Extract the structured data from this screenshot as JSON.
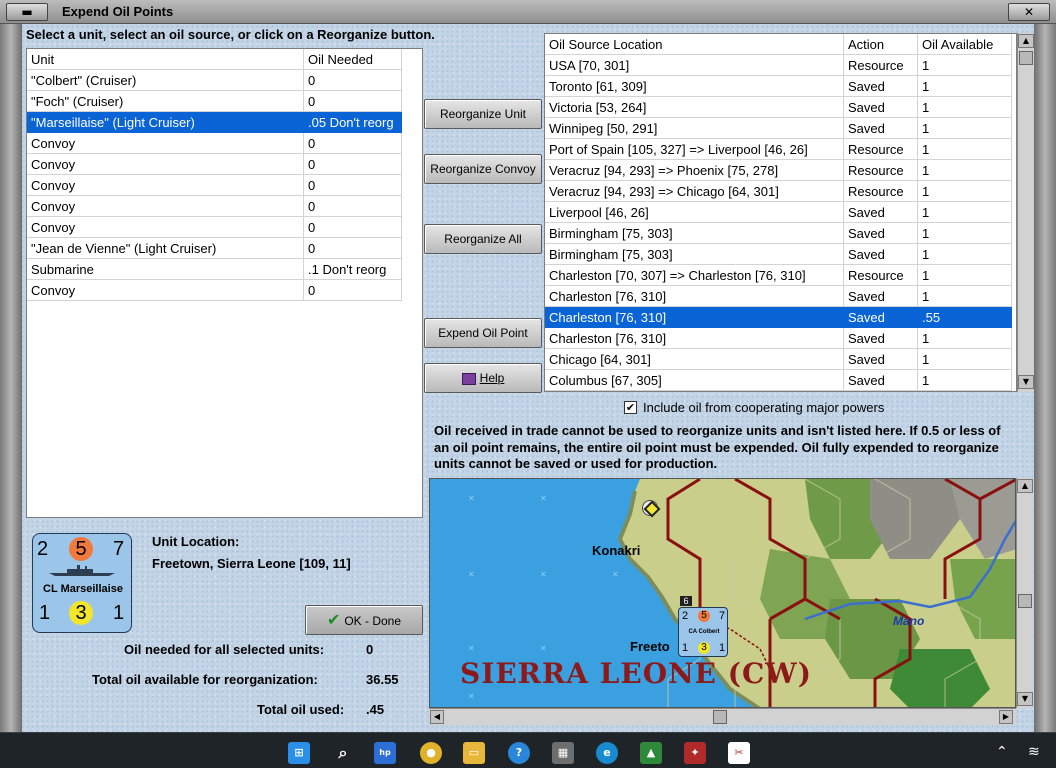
{
  "window": {
    "title": "Expend Oil Points",
    "min_label": "▬",
    "close_label": "✕"
  },
  "instruction": "Select a unit, select an oil source, or click on a Reorganize button.",
  "units_table": {
    "headers": [
      "Unit",
      "Oil Needed"
    ],
    "rows": [
      {
        "unit": "\"Colbert\" (Cruiser)",
        "oil": "0"
      },
      {
        "unit": "\"Foch\" (Cruiser)",
        "oil": "0"
      },
      {
        "unit": "\"Marseillaise\" (Light Cruiser)",
        "oil": ".05 Don't reorg"
      },
      {
        "unit": "Convoy",
        "oil": "0"
      },
      {
        "unit": "Convoy",
        "oil": "0"
      },
      {
        "unit": "Convoy",
        "oil": "0"
      },
      {
        "unit": "Convoy",
        "oil": "0"
      },
      {
        "unit": "Convoy",
        "oil": "0"
      },
      {
        "unit": "\"Jean de Vienne\" (Light Cruiser)",
        "oil": "0"
      },
      {
        "unit": "Submarine",
        "oil": ".1 Don't reorg"
      },
      {
        "unit": "Convoy",
        "oil": "0"
      }
    ],
    "selected_index": 2
  },
  "buttons": {
    "reorganize_unit": "Reorganize Unit",
    "reorganize_convoy": "Reorganize Convoy",
    "reorganize_all": "Reorganize All",
    "expend_oil_point": "Expend Oil Point",
    "help": "Help",
    "ok_done": "OK - Done"
  },
  "sources_table": {
    "headers": [
      "Oil Source Location",
      "Action",
      "Oil Available"
    ],
    "rows": [
      {
        "loc": "USA [70, 301]",
        "action": "Resource",
        "avail": "1"
      },
      {
        "loc": "Toronto [61, 309]",
        "action": "Saved",
        "avail": "1"
      },
      {
        "loc": "Victoria [53, 264]",
        "action": "Saved",
        "avail": "1"
      },
      {
        "loc": "Winnipeg [50, 291]",
        "action": "Saved",
        "avail": "1"
      },
      {
        "loc": "Port of Spain [105, 327] => Liverpool [46, 26]",
        "action": "Resource",
        "avail": "1"
      },
      {
        "loc": "Veracruz [94, 293] => Phoenix [75, 278]",
        "action": "Resource",
        "avail": "1"
      },
      {
        "loc": "Veracruz [94, 293] => Chicago [64, 301]",
        "action": "Resource",
        "avail": "1"
      },
      {
        "loc": "Liverpool [46, 26]",
        "action": "Saved",
        "avail": "1"
      },
      {
        "loc": "Birmingham [75, 303]",
        "action": "Saved",
        "avail": "1"
      },
      {
        "loc": "Birmingham [75, 303]",
        "action": "Saved",
        "avail": "1"
      },
      {
        "loc": "Charleston [70, 307] => Charleston [76, 310]",
        "action": "Resource",
        "avail": "1"
      },
      {
        "loc": "Charleston [76, 310]",
        "action": "Saved",
        "avail": "1"
      },
      {
        "loc": "Charleston [76, 310]",
        "action": "Saved",
        "avail": ".55"
      },
      {
        "loc": "Charleston [76, 310]",
        "action": "Saved",
        "avail": "1"
      },
      {
        "loc": "Chicago [64, 301]",
        "action": "Saved",
        "avail": "1"
      },
      {
        "loc": "Columbus [67, 305]",
        "action": "Saved",
        "avail": "1"
      }
    ],
    "selected_index": 12
  },
  "checkbox": {
    "label": "Include oil from cooperating major powers",
    "checked": true
  },
  "note": "Oil received in trade cannot be used to reorganize units and isn't listed here.  If 0.5 or less of an oil point remains, the entire oil point must be expended.   Oil fully expended to reorganize units cannot be saved or used for production.",
  "unit_counter": {
    "top_left": "2",
    "top_mid": "5",
    "top_right": "7",
    "name": "CL Marseillaise",
    "bottom_left": "1",
    "bottom_mid": "3",
    "bottom_right": "1"
  },
  "unit_location": {
    "label": "Unit Location:",
    "value": "Freetown, Sierra Leone [109, 11]"
  },
  "totals": {
    "needed_label": "Oil needed for all selected units:",
    "needed_value": "0",
    "available_label": "Total oil available for reorganization:",
    "available_value": "36.55",
    "used_label": "Total oil used:",
    "used_value": ".45"
  },
  "map": {
    "label_konakri": "Konakri",
    "label_freetown": "Freeto",
    "label_mano": "Mano",
    "label_region": "SIERRA LEONE (CW)",
    "mini_counter": {
      "top_left": "2",
      "top_mid": "5",
      "top_right": "7",
      "name": "CA Colbert",
      "bottom_left": "1",
      "bottom_mid": "3",
      "bottom_right": "1",
      "stack": "6"
    }
  },
  "taskbar": {
    "icons": [
      "windows-start",
      "search",
      "myhp",
      "chrome",
      "file-explorer",
      "help",
      "calculator",
      "edge",
      "game-launcher",
      "war-game",
      "snipping-tool"
    ]
  }
}
